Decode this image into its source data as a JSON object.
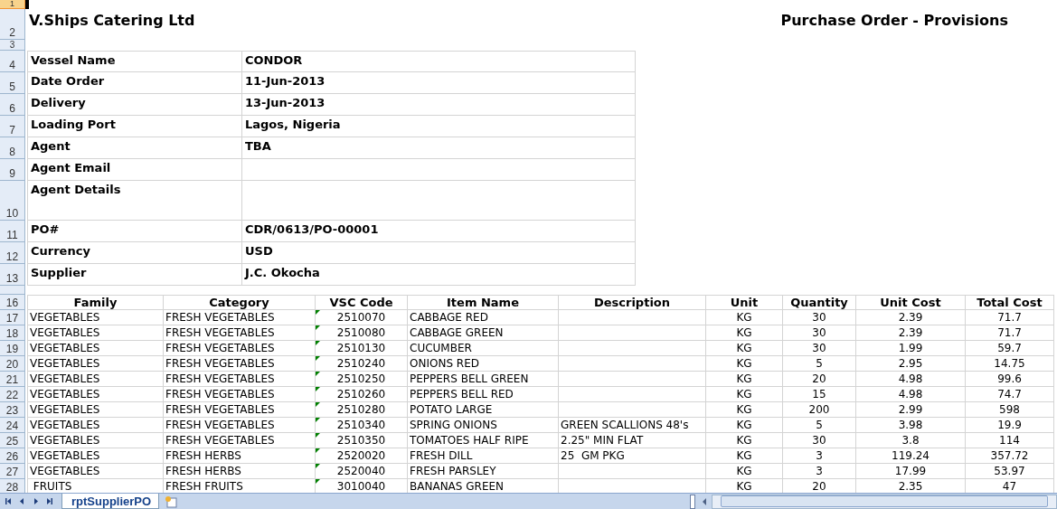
{
  "top_rows": [
    {
      "row": "1",
      "selected": true
    },
    {
      "row": "2",
      "selected": false
    },
    {
      "row": "3",
      "selected": false
    }
  ],
  "company": "V.Ships Catering Ltd",
  "document_title": "Purchase Order - Provisions",
  "info": [
    {
      "row": "4",
      "label": "Vessel Name",
      "value": "CONDOR"
    },
    {
      "row": "5",
      "label": "Date Order",
      "value": "11-Jun-2013"
    },
    {
      "row": "6",
      "label": "Delivery",
      "value": "13-Jun-2013"
    },
    {
      "row": "7",
      "label": "Loading Port",
      "value": "Lagos, Nigeria"
    },
    {
      "row": "8",
      "label": "Agent",
      "value": "TBA"
    },
    {
      "row": "9",
      "label": "Agent Email"
    },
    {
      "row": "10",
      "label": "Agent Details"
    },
    {
      "row": "11",
      "label": "PO#",
      "value": "CDR/0613/PO-00001"
    },
    {
      "row": "12",
      "label": "Currency",
      "value": "USD"
    },
    {
      "row": "13",
      "label": "Supplier",
      "value": "J.C. Okocha"
    }
  ],
  "table": {
    "row": "16",
    "columns": [
      "Family",
      "Category",
      "VSC Code",
      "Item Name",
      "Description",
      "Unit",
      "Quantity",
      "Unit Cost",
      "Total Cost"
    ],
    "rows": [
      {
        "row": "17",
        "flagged": true,
        "cells": [
          "VEGETABLES",
          "FRESH VEGETABLES",
          "2510070",
          "CABBAGE RED",
          "",
          "KG",
          "30",
          "2.39",
          "71.7"
        ]
      },
      {
        "row": "18",
        "flagged": true,
        "cells": [
          "VEGETABLES",
          "FRESH VEGETABLES",
          "2510080",
          "CABBAGE GREEN",
          "",
          "KG",
          "30",
          "2.39",
          "71.7"
        ]
      },
      {
        "row": "19",
        "flagged": true,
        "cells": [
          "VEGETABLES",
          "FRESH VEGETABLES",
          "2510130",
          "CUCUMBER",
          "",
          "KG",
          "30",
          "1.99",
          "59.7"
        ]
      },
      {
        "row": "20",
        "flagged": true,
        "cells": [
          "VEGETABLES",
          "FRESH VEGETABLES",
          "2510240",
          "ONIONS RED",
          "",
          "KG",
          "5",
          "2.95",
          "14.75"
        ]
      },
      {
        "row": "21",
        "flagged": true,
        "cells": [
          "VEGETABLES",
          "FRESH VEGETABLES",
          "2510250",
          "PEPPERS BELL GREEN",
          "",
          "KG",
          "20",
          "4.98",
          "99.6"
        ]
      },
      {
        "row": "22",
        "flagged": true,
        "cells": [
          "VEGETABLES",
          "FRESH VEGETABLES",
          "2510260",
          "PEPPERS BELL RED",
          "",
          "KG",
          "15",
          "4.98",
          "74.7"
        ]
      },
      {
        "row": "23",
        "flagged": true,
        "cells": [
          "VEGETABLES",
          "FRESH VEGETABLES",
          "2510280",
          "POTATO LARGE",
          "",
          "KG",
          "200",
          "2.99",
          "598"
        ]
      },
      {
        "row": "24",
        "flagged": true,
        "cells": [
          "VEGETABLES",
          "FRESH VEGETABLES",
          "2510340",
          "SPRING ONIONS",
          "GREEN SCALLIONS 48's",
          "KG",
          "5",
          "3.98",
          "19.9"
        ]
      },
      {
        "row": "25",
        "flagged": true,
        "cells": [
          "VEGETABLES",
          "FRESH VEGETABLES",
          "2510350",
          "TOMATOES HALF RIPE",
          "2.25\" MIN FLAT",
          "KG",
          "30",
          "3.8",
          "114"
        ]
      },
      {
        "row": "26",
        "flagged": true,
        "cells": [
          "VEGETABLES",
          "FRESH HERBS",
          "2520020",
          "FRESH DILL",
          "25  GM PKG",
          "KG",
          "3",
          "119.24",
          "357.72"
        ]
      },
      {
        "row": "27",
        "flagged": true,
        "cells": [
          "VEGETABLES",
          "FRESH HERBS",
          "2520040",
          "FRESH PARSLEY",
          "",
          "KG",
          "3",
          "17.99",
          "53.97"
        ]
      },
      {
        "row": "28",
        "flagged": true,
        "cells": [
          " FRUITS",
          "FRESH FRUITS",
          "3010040",
          "BANANAS GREEN",
          "",
          "KG",
          "20",
          "2.35",
          "47"
        ]
      }
    ]
  },
  "sheet_tabs": [
    {
      "label": "rptSupplierPO",
      "selected": true
    }
  ]
}
